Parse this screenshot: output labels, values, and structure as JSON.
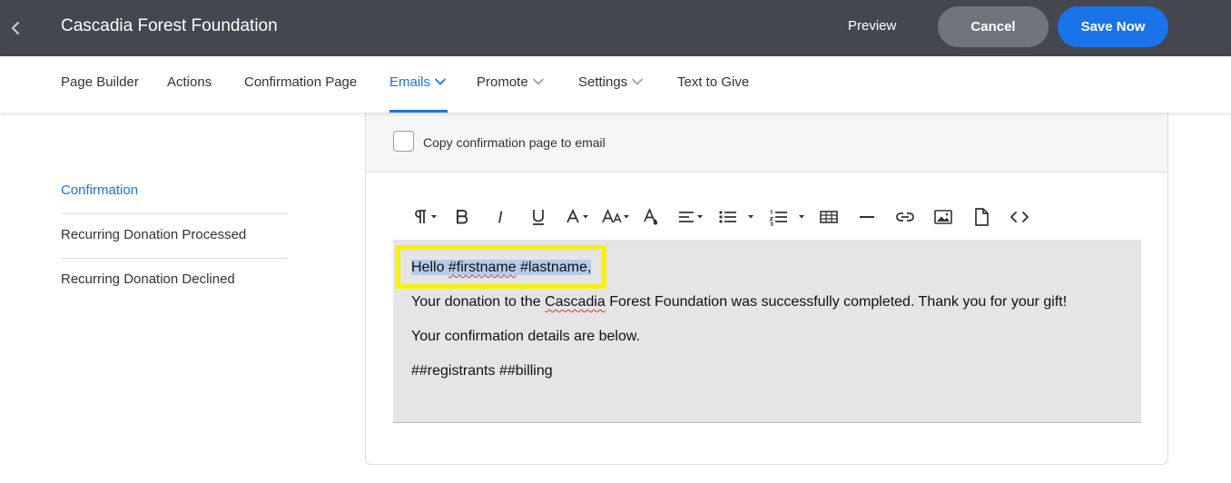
{
  "header": {
    "back_icon": "chevron-left-icon",
    "title": "Cascadia Forest Foundation",
    "preview_label": "Preview",
    "cancel_label": "Cancel",
    "save_label": "Save Now"
  },
  "nav": {
    "items": [
      {
        "label": "Page Builder"
      },
      {
        "label": "Actions"
      },
      {
        "label": "Confirmation Page"
      },
      {
        "label": "Emails",
        "active": true,
        "has_dropdown": true
      },
      {
        "label": "Promote",
        "has_dropdown": true
      },
      {
        "label": "Settings",
        "has_dropdown": true
      },
      {
        "label": "Text to Give"
      }
    ]
  },
  "sidebar": {
    "items": [
      {
        "label": "Confirmation",
        "active": true
      },
      {
        "label": "Recurring Donation Processed"
      },
      {
        "label": "Recurring Donation Declined"
      }
    ]
  },
  "email_panel": {
    "copy_checkbox_label": "Copy confirmation page to email",
    "copy_checked": false,
    "toolbar_icons": [
      "paragraph-format-icon",
      "bold-icon",
      "italic-icon",
      "underline-icon",
      "font-family-icon",
      "font-size-icon",
      "text-color-icon",
      "align-icon",
      "unordered-list-icon",
      "ordered-list-icon",
      "table-icon",
      "horizontal-line-icon",
      "link-icon",
      "image-icon",
      "file-icon",
      "code-view-icon"
    ],
    "editor": {
      "greeting_hello": "Hello ",
      "greeting_firstname": "#firstname",
      "greeting_space": " ",
      "greeting_lastname": "#lastname",
      "greeting_comma": ",",
      "body_before": "Your donation to the ",
      "body_org": "Cascadia",
      "body_after": " Forest Foundation was successfully completed. Thank you for your gift!",
      "details": "Your confirmation details are below.",
      "merge_tags": "##registrants ##billing"
    }
  },
  "colors": {
    "topbar": "#45474f",
    "accent": "#1a73e8",
    "cancel_button": "#71747b",
    "highlight_box": "#f7f10d",
    "selection": "#b4cbe9",
    "editor_bg": "#e5e5e5"
  }
}
